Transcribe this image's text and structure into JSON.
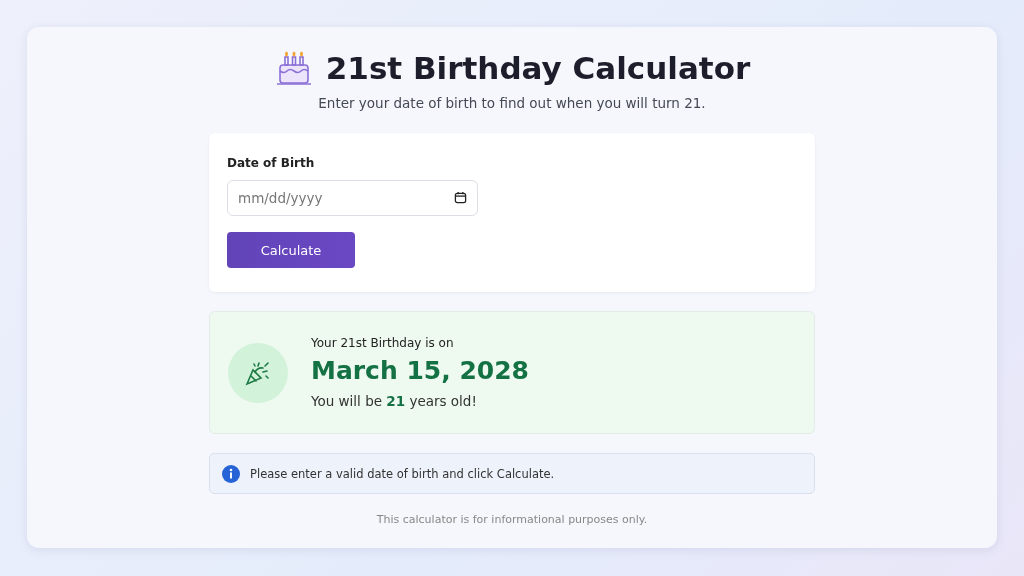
{
  "header": {
    "title": "21st Birthday Calculator",
    "subtitle": "Enter your date of birth to find out when you will turn 21."
  },
  "form": {
    "label": "Date of Birth",
    "date_field": {
      "placeholder": "mm/dd/yyyy"
    },
    "button": "Calculate"
  },
  "result": {
    "intro": "Your 21st Birthday is on",
    "date": "March 15, 2028",
    "age_line": "You will be **21** years old!"
  },
  "info": {
    "message": "Please enter a valid date of birth and click Calculate."
  },
  "footer": "This calculator is for informational purposes only."
}
